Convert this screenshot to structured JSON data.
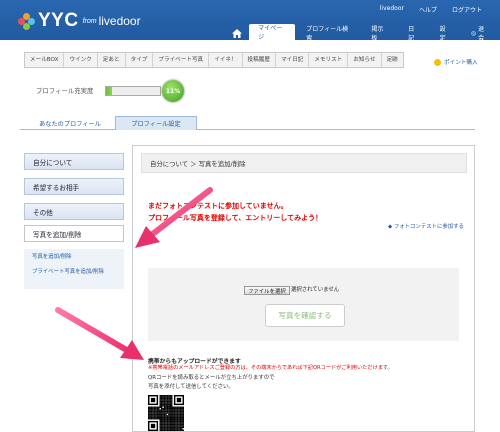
{
  "header": {
    "logo_text": "YYC",
    "logo_from": "from",
    "logo_brand": "livedoor",
    "top_links": [
      "livedoor",
      "ヘルプ",
      "ログアウト"
    ],
    "nav": [
      {
        "label": "マイページ",
        "active": true
      },
      {
        "label": "プロフィール検索",
        "active": false
      },
      {
        "label": "掲示板",
        "active": false
      },
      {
        "label": "日記",
        "active": false
      },
      {
        "label": "設定",
        "active": false
      },
      {
        "label": "退会",
        "active": false
      }
    ]
  },
  "tabs": [
    "メールBOX",
    "ウインク",
    "足あと",
    "タイプ",
    "プライベート写真",
    "イイネ！",
    "投稿履歴",
    "マイ日記",
    "メモリスト",
    "お知らせ",
    "足跡"
  ],
  "points_link": "ポイント購入",
  "profile_progress": {
    "label": "プロフィール充実度",
    "value": "11%",
    "fraction": 0.11
  },
  "subtabs": {
    "profile": "あなたのプロフィール",
    "settings": "プロフィール設定"
  },
  "sidebar": {
    "items": [
      {
        "label": "自分について"
      },
      {
        "label": "希望するお相手"
      },
      {
        "label": "その他"
      },
      {
        "label": "写真を追加/削除"
      }
    ],
    "sub_links": [
      "写真を追加/削除",
      "プライベート写真を追加/削除"
    ]
  },
  "main": {
    "breadcrumb": "自分について ＞ 写真を追加/削除",
    "notice_line1": "まだフォトコンテストに参加していません。",
    "notice_line2": "プロフィール写真を登録して、エントリーしてみよう！",
    "contest_link": "フォトコンテストに参加する",
    "file_button": "ファイルを選択",
    "file_status": "選択されていません",
    "confirm_button": "写真を確認する",
    "mobile_title": "携帯からもアップロードができます",
    "mobile_note": "※携帯電話のメールアドレスご登録の方は、その端末からであれば下記QRコードがご利用いただけます。",
    "mobile_inst1": "QRコードを読み取るとメールが立ち上がりますので",
    "mobile_inst2": "写真を添付して送信してください。"
  },
  "colors": {
    "header_blue": "#215aa0",
    "accent_red": "#e00000",
    "progress_green": "#6fbe3e",
    "arrow_pink": "#f0457a",
    "confirm_text": "#8bbd7a"
  }
}
